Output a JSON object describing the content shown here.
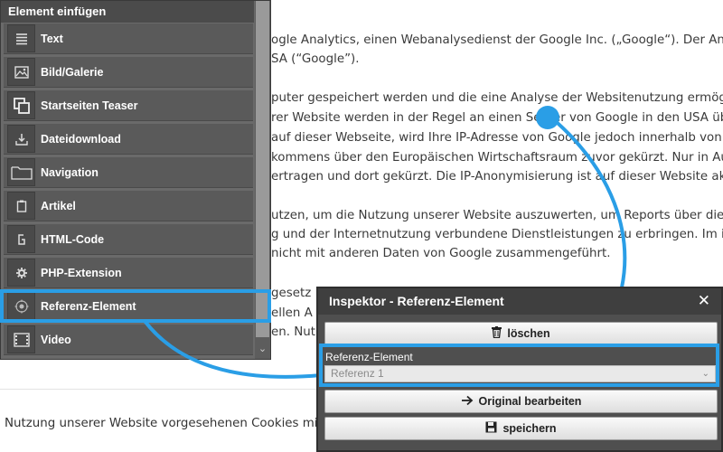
{
  "article": {
    "lines": [
      "ogle Analytics, einen Webanalysedienst der Google Inc. („Google“). Der Anbiete",
      "SA (“Google”).",
      "puter gespeichert werden und die eine Analyse der Websitenutzung ermögli",
      "rer Website werden in der Regel an einen Server von Google in den USA über",
      "auf dieser Webseite, wird Ihre IP-Adresse von Google jedoch innerhalb von Mit",
      "kommens über den Europäischen Wirtschaftsraum zuvor gekürzt. Nur in Ausn",
      "ertragen und dort gekürzt. Die IP-Anonymisierung ist auf dieser Website aktiv.",
      "utzen, um die Nutzung unserer Website auszuwerten, um Reports über die We",
      "g und der Internetnutzung verbundene Dienstleistungen zu erbringen. Im in",
      "nicht mit anderen Daten von Google zusammengeführt.",
      "gesetz",
      "ellen A",
      "en. Nut"
    ],
    "bottom_line": "Nutzung unserer Website vorgesehenen Cookies mi"
  },
  "insert_panel": {
    "title": "Element einfügen",
    "items": [
      {
        "label": "Text",
        "icon": "text-lines-icon"
      },
      {
        "label": "Bild/Galerie",
        "icon": "image-icon"
      },
      {
        "label": "Startseiten Teaser",
        "icon": "teaser-icon"
      },
      {
        "label": "Dateidownload",
        "icon": "download-icon"
      },
      {
        "label": "Navigation",
        "icon": "folder-icon"
      },
      {
        "label": "Artikel",
        "icon": "article-icon"
      },
      {
        "label": "HTML-Code",
        "icon": "code-icon"
      },
      {
        "label": "PHP-Extension",
        "icon": "gear-icon"
      },
      {
        "label": "Referenz-Element",
        "icon": "target-icon"
      },
      {
        "label": "Video",
        "icon": "film-icon"
      }
    ]
  },
  "inspector": {
    "title": "Inspektor - Referenz-Element",
    "delete_label": "löschen",
    "field_label": "Referenz-Element",
    "field_value": "Referenz 1",
    "edit_original_label": "Original bearbeiten",
    "save_label": "speichern"
  },
  "colors": {
    "highlight": "#2a9ee6",
    "panel_bg": "#6a6a6a",
    "inspector_bg": "#4f4f4f"
  }
}
